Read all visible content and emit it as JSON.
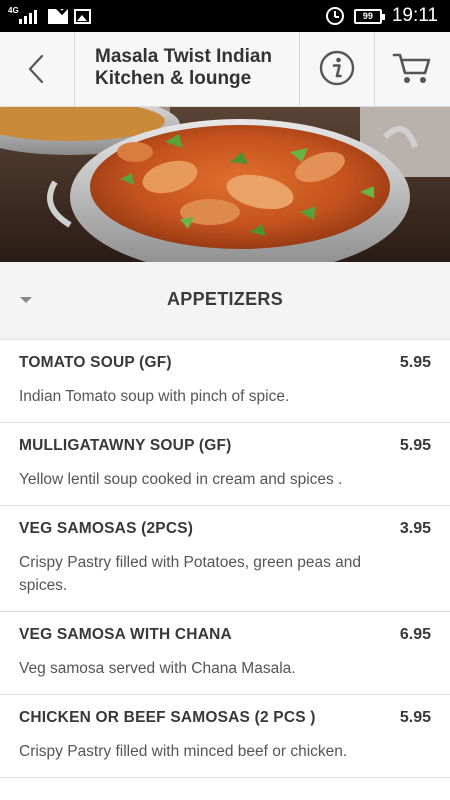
{
  "status_bar": {
    "network": "4G",
    "battery": "99",
    "time": "19:11"
  },
  "header": {
    "title": "Masala Twist Indian Kitchen & lounge"
  },
  "category": {
    "label": "APPETIZERS"
  },
  "menu_items": [
    {
      "name": "TOMATO SOUP (GF)",
      "price": "5.95",
      "description": "Indian Tomato soup with pinch of spice."
    },
    {
      "name": "MULLIGATAWNY SOUP (GF)",
      "price": "5.95",
      "description": "Yellow lentil soup cooked in cream and spices ."
    },
    {
      "name": "VEG SAMOSAS (2PCS)",
      "price": "3.95",
      "description": "Crispy Pastry filled with Potatoes, green peas and spices."
    },
    {
      "name": "VEG SAMOSA WITH CHANA",
      "price": "6.95",
      "description": "Veg samosa served with Chana Masala."
    },
    {
      "name": "CHICKEN OR BEEF SAMOSAS (2 PCS )",
      "price": "5.95",
      "description": "Crispy Pastry filled with minced beef or chicken."
    }
  ],
  "colors": {
    "header_bg": "#f7f7f7",
    "category_bg": "#f4f4f4",
    "text": "#383838"
  }
}
